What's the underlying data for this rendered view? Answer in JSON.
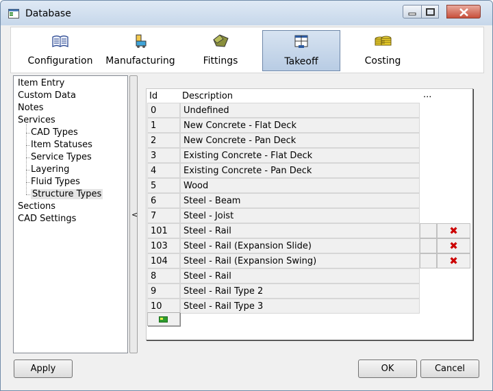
{
  "window": {
    "title": "Database",
    "controls": {
      "minimize": "minimize",
      "maximize": "maximize",
      "close": "close"
    }
  },
  "toolbar": {
    "items": [
      {
        "label": "Configuration",
        "icon": "book-icon",
        "selected": false
      },
      {
        "label": "Manufacturing",
        "icon": "machine-icon",
        "selected": false
      },
      {
        "label": "Fittings",
        "icon": "fittings-icon",
        "selected": false
      },
      {
        "label": "Takeoff",
        "icon": "takeoff-icon",
        "selected": true
      },
      {
        "label": "Costing",
        "icon": "coins-icon",
        "selected": false
      }
    ]
  },
  "tree": {
    "items": [
      {
        "label": "Item Entry",
        "level": 0
      },
      {
        "label": "Custom Data",
        "level": 0
      },
      {
        "label": "Notes",
        "level": 0
      },
      {
        "label": "Services",
        "level": 0
      },
      {
        "label": "CAD Types",
        "level": 1
      },
      {
        "label": "Item Statuses",
        "level": 1
      },
      {
        "label": "Service Types",
        "level": 1
      },
      {
        "label": "Layering",
        "level": 1
      },
      {
        "label": "Fluid Types",
        "level": 1
      },
      {
        "label": "Structure Types",
        "level": 1,
        "selected": true
      },
      {
        "label": "Sections",
        "level": 0
      },
      {
        "label": "CAD Settings",
        "level": 0
      }
    ]
  },
  "splitter": {
    "label": "<"
  },
  "grid": {
    "headers": {
      "id": "Id",
      "description": "Description",
      "more": "..."
    },
    "rows": [
      {
        "id": "0",
        "description": "Undefined",
        "deletable": false
      },
      {
        "id": "1",
        "description": "New Concrete - Flat Deck",
        "deletable": false
      },
      {
        "id": "2",
        "description": "New Concrete - Pan Deck",
        "deletable": false
      },
      {
        "id": "3",
        "description": "Existing Concrete - Flat Deck",
        "deletable": false
      },
      {
        "id": "4",
        "description": "Existing Concrete - Pan Deck",
        "deletable": false
      },
      {
        "id": "5",
        "description": "Wood",
        "deletable": false
      },
      {
        "id": "6",
        "description": "Steel - Beam",
        "deletable": false
      },
      {
        "id": "7",
        "description": "Steel - Joist",
        "deletable": false
      },
      {
        "id": "101",
        "description": "Steel - Rail",
        "deletable": true
      },
      {
        "id": "103",
        "description": "Steel - Rail (Expansion Slide)",
        "deletable": true
      },
      {
        "id": "104",
        "description": "Steel - Rail (Expansion Swing)",
        "deletable": true
      },
      {
        "id": "8",
        "description": "Steel - Rail",
        "deletable": false
      },
      {
        "id": "9",
        "description": "Steel - Rail Type 2",
        "deletable": false
      },
      {
        "id": "10",
        "description": "Steel - Rail Type 3",
        "deletable": false
      }
    ],
    "delete_glyph": "✖"
  },
  "footer": {
    "apply_label": "Apply",
    "ok_label": "OK",
    "cancel_label": "Cancel"
  },
  "colors": {
    "selected_tool_bg": "#b8cce4",
    "delete_icon": "#cc0000",
    "close_button": "#c7503c"
  }
}
